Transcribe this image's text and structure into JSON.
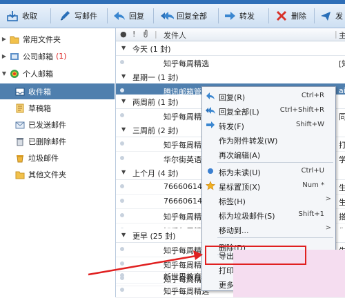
{
  "toolbar": {
    "receive": "收取",
    "compose": "写邮件",
    "reply": "回复",
    "reply_all": "回复全部",
    "forward": "转发",
    "delete": "删除",
    "more": "发"
  },
  "sidebar": {
    "items": [
      {
        "label": "常用文件夹",
        "icon": "folder-icon"
      },
      {
        "label": "公司邮箱",
        "count": "(1)",
        "icon": "mailbox-icon"
      },
      {
        "label": "个人邮箱",
        "icon": "qq-mail-icon"
      },
      {
        "label": "收件箱",
        "icon": "inbox-icon"
      },
      {
        "label": "草稿箱",
        "icon": "drafts-icon"
      },
      {
        "label": "已发送邮件",
        "icon": "sent-icon"
      },
      {
        "label": "已删除邮件",
        "icon": "trash-icon"
      },
      {
        "label": "垃圾邮件",
        "icon": "spam-icon"
      },
      {
        "label": "其他文件夹",
        "icon": "folder-icon"
      }
    ]
  },
  "list": {
    "col_sender": "发件人",
    "col_subject": "主",
    "groups": [
      {
        "label": "今天 (1 封)"
      },
      {
        "label": "星期一 (1 封)"
      },
      {
        "label": "两周前 (1 封)"
      },
      {
        "label": "三周前 (2 封)"
      },
      {
        "label": "上个月 (4 封)"
      },
      {
        "label": "更早 (25 封)"
      }
    ],
    "rows": [
      {
        "sender": "知乎每周精选",
        "subject": "[知"
      },
      {
        "sender": "腾讯邮箱管理员",
        "subject": "ai"
      },
      {
        "sender": "知乎每周精选",
        "subject": "同从"
      },
      {
        "sender": "知乎每周精选",
        "subject": "打石"
      },
      {
        "sender": "华尔街英语",
        "subject": "学台"
      },
      {
        "sender": "766606145",
        "subject": "生日"
      },
      {
        "sender": "766606145",
        "subject": "生日"
      },
      {
        "sender": "知乎每周精选",
        "subject": "搭耳"
      },
      {
        "sender": "知乎每周精选",
        "subject": "为什"
      },
      {
        "sender": "知乎每周精选",
        "subject": "生日"
      },
      {
        "sender": "知乎每周精",
        "subject": ""
      },
      {
        "sender": "知乎每周精选",
        "subject": ""
      },
      {
        "sender": "新世界教育",
        "subject": ""
      },
      {
        "sender": "知乎每周精选",
        "subject": ""
      }
    ]
  },
  "context_menu": {
    "items": [
      {
        "label": "回复(R)",
        "shortcut": "Ctrl+R",
        "icon": "reply-icon"
      },
      {
        "label": "回复全部(L)",
        "shortcut": "Ctrl+Shift+R",
        "icon": "reply-all-icon"
      },
      {
        "label": "转发(F)",
        "shortcut": "Shift+W",
        "icon": "forward-icon"
      },
      {
        "label": "作为附件转发(W)",
        "shortcut": ""
      },
      {
        "label": "再次编辑(A)",
        "shortcut": ""
      },
      {
        "label": "标为未读(U)",
        "shortcut": "Ctrl+U",
        "icon": "unread-dot-icon"
      },
      {
        "label": "星标置顶(X)",
        "shortcut": "Num *",
        "icon": "star-icon"
      },
      {
        "label": "标签(H)",
        "shortcut": "",
        "submenu": true
      },
      {
        "label": "标为垃圾邮件(S)",
        "shortcut": "Shift+1"
      },
      {
        "label": "移动到...",
        "shortcut": "",
        "submenu": true
      },
      {
        "label": "删除(D)",
        "shortcut": ""
      },
      {
        "label": "导出邮",
        "shortcut": ""
      },
      {
        "label": "打印",
        "shortcut": ""
      },
      {
        "label": "更多",
        "shortcut": ""
      }
    ]
  },
  "colors": {
    "selection": "#4f7fae",
    "highlight_box": "#e02020",
    "unread_count": "#d22"
  }
}
